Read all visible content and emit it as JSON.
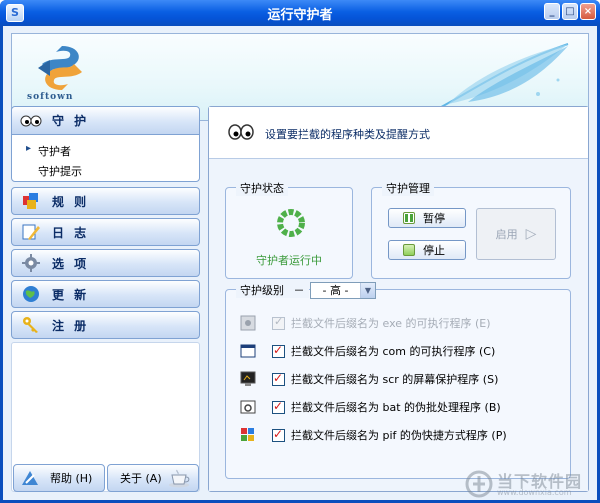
{
  "window": {
    "title": "运行守护者",
    "icon_label": "S",
    "controls": {
      "minimize": "_",
      "maximize": "□",
      "close": "×"
    }
  },
  "banner": {
    "logo_text": "softown"
  },
  "sidebar": {
    "sections": [
      {
        "label": "守 护",
        "icon": "eyes-icon",
        "expanded": true,
        "subitems": [
          {
            "label": "守护者",
            "active": true
          },
          {
            "label": "守护提示",
            "active": false
          }
        ]
      },
      {
        "label": "规 则",
        "icon": "rules-cube-icon"
      },
      {
        "label": "日 志",
        "icon": "log-pencil-icon"
      },
      {
        "label": "选 项",
        "icon": "options-gear-icon"
      },
      {
        "label": "更 新",
        "icon": "update-globe-icon"
      },
      {
        "label": "注 册",
        "icon": "register-key-icon"
      }
    ],
    "help_button": "帮助 (H)",
    "about_button": "关于 (A)"
  },
  "main": {
    "header": "设置要拦截的程序种类及提醒方式",
    "status_group": {
      "title": "守护状态",
      "status_text": "守护者运行中"
    },
    "manage_group": {
      "title": "守护管理",
      "pause": "暂停",
      "stop": "停止",
      "launch": "启用"
    },
    "level_group": {
      "title": "守护级别",
      "dash": "－",
      "level_value": "- 高 -",
      "options": [
        {
          "label": "拦截文件后缀名为 exe 的可执行程序 (E)",
          "checked": true,
          "enabled": false,
          "icon": "exe-file-icon"
        },
        {
          "label": "拦截文件后缀名为 com 的可执行程序 (C)",
          "checked": true,
          "enabled": true,
          "icon": "com-window-icon"
        },
        {
          "label": "拦截文件后缀名为 scr 的屏幕保护程序 (S)",
          "checked": true,
          "enabled": true,
          "icon": "scr-monitor-icon"
        },
        {
          "label": "拦截文件后缀名为 bat 的伪批处理程序 (B)",
          "checked": true,
          "enabled": true,
          "icon": "bat-gear-icon"
        },
        {
          "label": "拦截文件后缀名为 pif 的伪快捷方式程序 (P)",
          "checked": true,
          "enabled": true,
          "icon": "pif-shortcut-icon"
        }
      ]
    }
  },
  "watermark": {
    "title": "当下软件园",
    "url": "www.downxia.com"
  },
  "colors": {
    "titlebar": "#0a5fe3",
    "accent": "#0b2c66",
    "status_green": "#3a9a3a",
    "check_red": "#d61a1a"
  }
}
